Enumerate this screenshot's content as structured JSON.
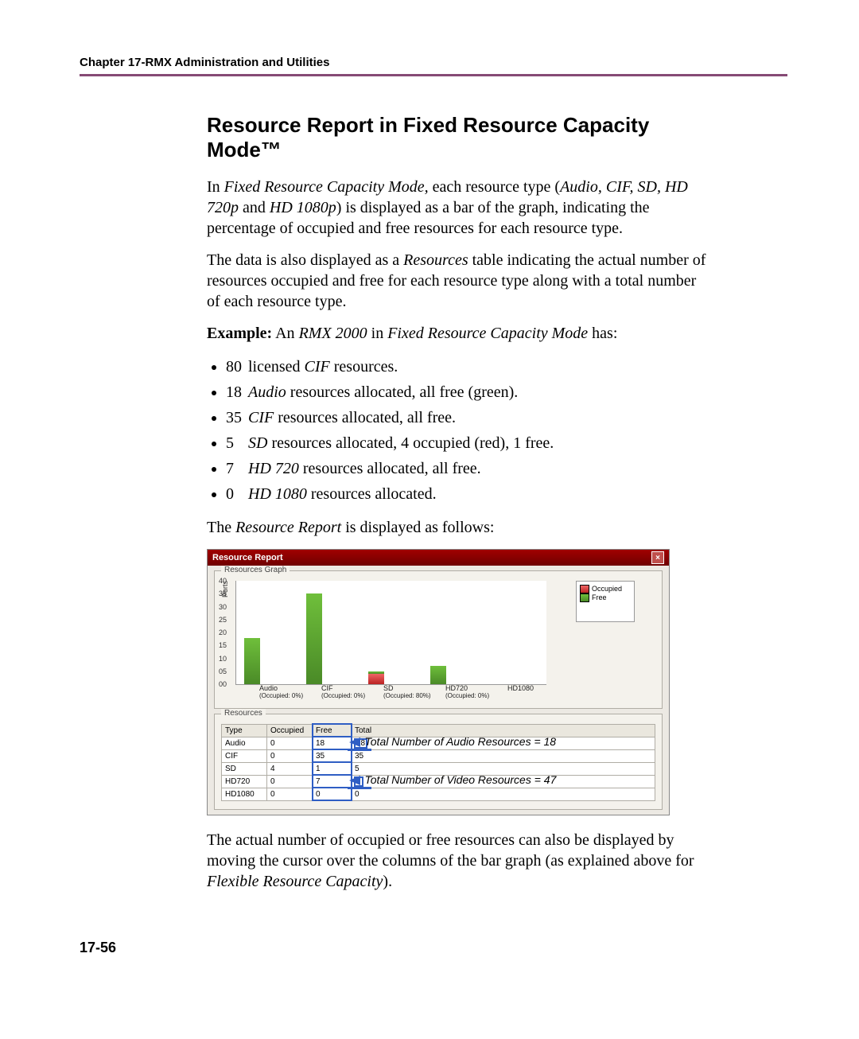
{
  "header": {
    "chapter": "Chapter 17-RMX Administration and Utilities"
  },
  "section_title": "Resource Report in Fixed Resource Capacity Mode™",
  "para1_pre": "In ",
  "para1_em1": "Fixed Resource Capacity Mode,",
  "para1_mid": " each resource type (",
  "para1_em2": "Audio, CIF, SD, HD 720p",
  "para1_mid2": " and ",
  "para1_em3": "HD 1080p",
  "para1_post": ") is displayed as a bar of the graph, indicating the percentage of occupied and free resources for each resource type.",
  "para2_pre": "The data is also displayed as a ",
  "para2_em": "Resources",
  "para2_post": " table indicating the actual number of resources occupied and free for each resource type along with a total number of each resource type.",
  "example_label": "Example:",
  "example_post_pre": " An ",
  "example_em1": "RMX 2000",
  "example_mid": " in ",
  "example_em2": "Fixed Resource Capacity Mode",
  "example_post": " has:",
  "bullets": [
    {
      "n": "80",
      "pre": "licensed ",
      "em": "CIF",
      "post": " resources."
    },
    {
      "n": "18",
      "pre": "",
      "em": "Audio",
      "post": " resources allocated, all free (green)."
    },
    {
      "n": "35",
      "pre": "",
      "em": "CIF",
      "post": " resources allocated, all free."
    },
    {
      "n": "5",
      "pre": "",
      "em": "SD",
      "post": " resources allocated, 4 occupied (red), 1 free."
    },
    {
      "n": "7",
      "pre": "",
      "em": "HD 720",
      "post": " resources allocated, all free."
    },
    {
      "n": "0",
      "pre": "",
      "em": "HD 1080",
      "post": " resources allocated."
    }
  ],
  "para3_pre": "The ",
  "para3_em": "Resource Report",
  "para3_post": " is displayed as follows:",
  "dialog": {
    "title": "Resource Report",
    "group_graph": "Resources Graph",
    "group_table": "Resources",
    "ylabel": "Ports",
    "legend": {
      "occupied": "Occupied",
      "free": "Free"
    },
    "xcats": [
      {
        "name": "Audio",
        "sub": "(Occupied: 0%)"
      },
      {
        "name": "CIF",
        "sub": "(Occupied: 0%)"
      },
      {
        "name": "SD",
        "sub": "(Occupied: 80%)"
      },
      {
        "name": "HD720",
        "sub": "(Occupied: 0%)"
      },
      {
        "name": "HD1080",
        "sub": ""
      }
    ],
    "table": {
      "headers": {
        "type": "Type",
        "occ": "Occupied",
        "free": "Free",
        "total": "Total"
      },
      "rows": [
        {
          "type": "Audio",
          "occ": "0",
          "free": "18",
          "total": "18"
        },
        {
          "type": "CIF",
          "occ": "0",
          "free": "35",
          "total": "35"
        },
        {
          "type": "SD",
          "occ": "4",
          "free": "1",
          "total": "5"
        },
        {
          "type": "HD720",
          "occ": "0",
          "free": "7",
          "total": "7"
        },
        {
          "type": "HD1080",
          "occ": "0",
          "free": "0",
          "total": "0"
        }
      ],
      "annot_audio": "Total Number of Audio Resources = 18",
      "annot_video": "Total Number of Video Resources = 47"
    }
  },
  "chart_data": {
    "type": "bar",
    "ylabel": "Ports",
    "ylim": [
      0,
      40
    ],
    "yticks": [
      0,
      5,
      10,
      15,
      20,
      25,
      30,
      35,
      40
    ],
    "categories": [
      "Audio",
      "CIF",
      "SD",
      "HD720",
      "HD1080"
    ],
    "series": [
      {
        "name": "Occupied",
        "values": [
          0,
          0,
          4,
          0,
          0
        ]
      },
      {
        "name": "Free",
        "values": [
          18,
          35,
          1,
          7,
          0
        ]
      }
    ],
    "occupied_pct": [
      "0%",
      "0%",
      "80%",
      "0%",
      ""
    ]
  },
  "para4_pre": "The actual number of occupied or free resources can also be displayed by moving the cursor over the columns of the bar graph (as explained above for ",
  "para4_em": "Flexible Resource Capacity",
  "para4_post": ").",
  "page_number": "17-56"
}
